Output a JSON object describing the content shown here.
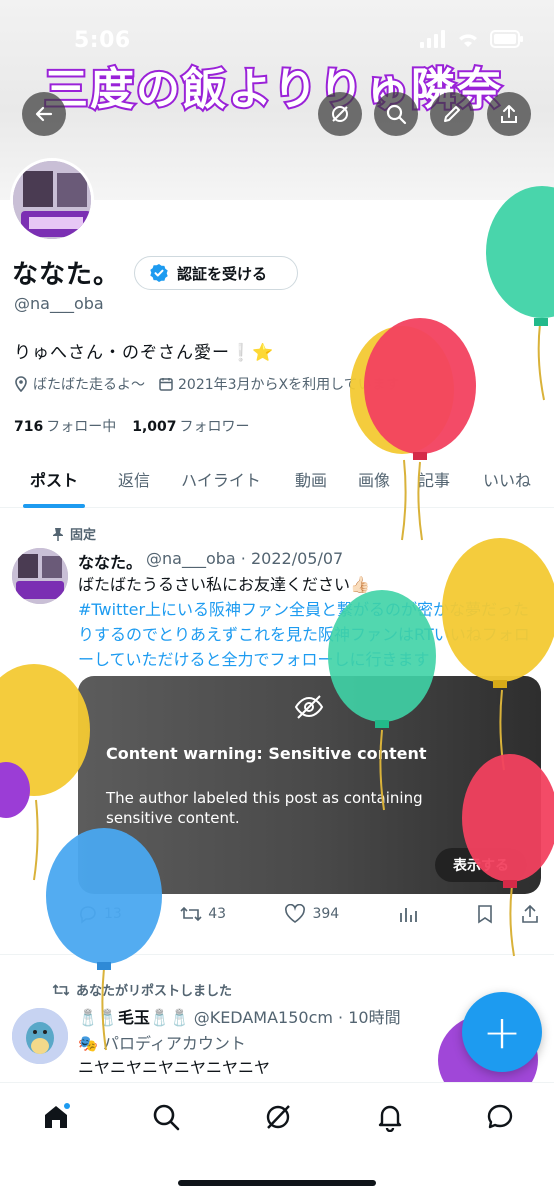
{
  "status_bar": {
    "time": "5:06"
  },
  "banner": {
    "art_text": "三度の飯よりりゅ隣奈"
  },
  "top_nav": {
    "back_icon": "arrow-left-icon",
    "grok_icon": "grok-icon",
    "search_icon": "search-icon",
    "edit_icon": "pencil-icon",
    "share_icon": "share-icon"
  },
  "profile": {
    "display_name": "ななた。",
    "verify_button": "認証を受ける",
    "handle": "@na___oba",
    "bio": "りゅへさん・のぞさん愛ー❕⭐",
    "location": "ばたばた走るよ〜",
    "joined": "2021年3月からXを利用しています",
    "following_count": "716",
    "following_label": "フォロー中",
    "followers_count": "1,007",
    "followers_label": "フォロワー"
  },
  "tabs": [
    {
      "label": "ポスト",
      "active": true
    },
    {
      "label": "返信",
      "active": false
    },
    {
      "label": "ハイライト",
      "active": false
    },
    {
      "label": "動画",
      "active": false
    },
    {
      "label": "画像",
      "active": false
    },
    {
      "label": "記事",
      "active": false
    },
    {
      "label": "いいね",
      "active": false
    }
  ],
  "pinned_tweet": {
    "pinned_label": "固定",
    "name": "ななた。",
    "handle_date": "@na___oba · 2022/05/07",
    "line1": "ばたばたうるさい私にお友達ください👍🏻",
    "hashtag_line": "#Twitter上にいる阪神ファン全員と繋がるのが密かな夢だったりするのでとりあえずこれを見た阪神ファンはRTいいねフォローしていただけると全力でフォローしに行きます",
    "warning_title": "Content warning: Sensitive content",
    "warning_body": "The author labeled this post as containing sensitive content.",
    "show_button": "表示する",
    "reply_count": "13",
    "retweet_count": "43",
    "like_count": "394"
  },
  "repost_tweet": {
    "repost_label": "あなたがリポストしました",
    "name": "🧂🧂毛玉🧂🧂",
    "handle_time": "@KEDAMA150cm · 10時間",
    "parody_label": "🎭 パロディアカウント",
    "text": "ニヤニヤニヤニヤニヤニヤ"
  },
  "fab": {
    "label": "+"
  },
  "bottom_nav": [
    "home-icon",
    "search-icon",
    "grok-icon",
    "bell-icon",
    "messages-icon"
  ],
  "colors": {
    "accent": "#1d9bf0",
    "text": "#0f1419",
    "muted": "#536471"
  }
}
